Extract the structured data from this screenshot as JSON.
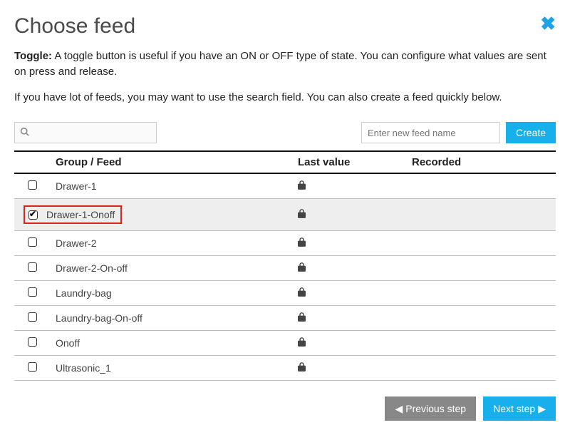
{
  "header": {
    "title": "Choose feed"
  },
  "description": {
    "bold_label": "Toggle:",
    "toggle_text": " A toggle button is useful if you have an ON or OFF type of state. You can configure what values are sent on press and release.",
    "search_hint": "If you have lot of feeds, you may want to use the search field. You can also create a feed quickly below."
  },
  "search": {
    "placeholder": ""
  },
  "create": {
    "placeholder": "Enter new feed name",
    "button_label": "Create"
  },
  "table": {
    "headers": {
      "group_feed": "Group / Feed",
      "last_value": "Last value",
      "recorded": "Recorded"
    },
    "rows": [
      {
        "name": "Drawer-1",
        "checked": false,
        "locked": true,
        "last_value": "",
        "recorded": "",
        "highlighted": false
      },
      {
        "name": "Drawer-1-Onoff",
        "checked": true,
        "locked": true,
        "last_value": "",
        "recorded": "",
        "highlighted": true
      },
      {
        "name": "Drawer-2",
        "checked": false,
        "locked": true,
        "last_value": "",
        "recorded": "",
        "highlighted": false
      },
      {
        "name": "Drawer-2-On-off",
        "checked": false,
        "locked": true,
        "last_value": "",
        "recorded": "",
        "highlighted": false
      },
      {
        "name": "Laundry-bag",
        "checked": false,
        "locked": true,
        "last_value": "",
        "recorded": "",
        "highlighted": false
      },
      {
        "name": "Laundry-bag-On-off",
        "checked": false,
        "locked": true,
        "last_value": "",
        "recorded": "",
        "highlighted": false
      },
      {
        "name": "Onoff",
        "checked": false,
        "locked": true,
        "last_value": "",
        "recorded": "",
        "highlighted": false
      },
      {
        "name": "Ultrasonic_1",
        "checked": false,
        "locked": true,
        "last_value": "",
        "recorded": "",
        "highlighted": false
      }
    ]
  },
  "footer": {
    "prev_label": "Previous step",
    "next_label": "Next step"
  }
}
